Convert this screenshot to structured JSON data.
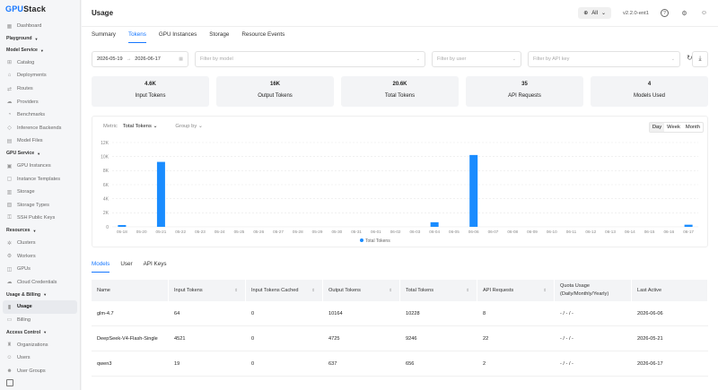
{
  "app": {
    "logo_prefix": "GPU",
    "logo_suffix": "Stack"
  },
  "sidebar": {
    "entries": [
      {
        "kind": "item",
        "label": "Dashboard",
        "icon": "▦",
        "active": false
      },
      {
        "kind": "group",
        "label": "Playground"
      },
      {
        "kind": "group",
        "label": "Model Service"
      },
      {
        "kind": "item",
        "label": "Catalog",
        "icon": "⊞",
        "active": false
      },
      {
        "kind": "item",
        "label": "Deployments",
        "icon": "⌂",
        "active": false
      },
      {
        "kind": "item",
        "label": "Routes",
        "icon": "⇄",
        "active": false
      },
      {
        "kind": "item",
        "label": "Providers",
        "icon": "☁",
        "active": false
      },
      {
        "kind": "item",
        "label": "Benchmarks",
        "icon": "◔",
        "active": false
      },
      {
        "kind": "item",
        "label": "Inference Backends",
        "icon": "◇",
        "active": false
      },
      {
        "kind": "item",
        "label": "Model Files",
        "icon": "▤",
        "active": false
      },
      {
        "kind": "group",
        "label": "GPU Service"
      },
      {
        "kind": "item",
        "label": "GPU Instances",
        "icon": "▣",
        "active": false
      },
      {
        "kind": "item",
        "label": "Instance Templates",
        "icon": "▢",
        "active": false
      },
      {
        "kind": "item",
        "label": "Storage",
        "icon": "▥",
        "active": false
      },
      {
        "kind": "item",
        "label": "Storage Types",
        "icon": "▧",
        "active": false
      },
      {
        "kind": "item",
        "label": "SSH Public Keys",
        "icon": "⚿",
        "active": false
      },
      {
        "kind": "group",
        "label": "Resources"
      },
      {
        "kind": "item",
        "label": "Clusters",
        "icon": "✲",
        "active": false
      },
      {
        "kind": "item",
        "label": "Workers",
        "icon": "⚙",
        "active": false
      },
      {
        "kind": "item",
        "label": "GPUs",
        "icon": "◫",
        "active": false
      },
      {
        "kind": "item",
        "label": "Cloud Credentials",
        "icon": "☁",
        "active": false
      },
      {
        "kind": "group",
        "label": "Usage & Billing"
      },
      {
        "kind": "item",
        "label": "Usage",
        "icon": "▮",
        "active": true
      },
      {
        "kind": "item",
        "label": "Billing",
        "icon": "▭",
        "active": false
      },
      {
        "kind": "group",
        "label": "Access Control"
      },
      {
        "kind": "item",
        "label": "Organizations",
        "icon": "♜",
        "active": false
      },
      {
        "kind": "item",
        "label": "Users",
        "icon": "☺",
        "active": false
      },
      {
        "kind": "item",
        "label": "User Groups",
        "icon": "☻",
        "active": false
      }
    ]
  },
  "header": {
    "title": "Usage",
    "scope": "All",
    "version": "v2.2.0-ent1"
  },
  "tabs": [
    "Summary",
    "Tokens",
    "GPU Instances",
    "Storage",
    "Resource Events"
  ],
  "active_tab": 1,
  "filters": {
    "date_from": "2026-05-19",
    "date_to": "2026-06-17",
    "model_placeholder": "Filter by model",
    "user_placeholder": "Filter by user",
    "apikey_placeholder": "Filter by API key"
  },
  "cards": [
    {
      "value": "4.6K",
      "label": "Input Tokens"
    },
    {
      "value": "16K",
      "label": "Output Tokens"
    },
    {
      "value": "20.6K",
      "label": "Total Tokens"
    },
    {
      "value": "35",
      "label": "API Requests"
    },
    {
      "value": "4",
      "label": "Models Used"
    }
  ],
  "chart_controls": {
    "metric_label": "Metric",
    "metric_value": "Total Tokens",
    "group_by_label": "Group by",
    "periods": [
      "Day",
      "Week",
      "Month"
    ],
    "active_period": 0
  },
  "chart_data": {
    "type": "bar",
    "ylim": [
      0,
      12000
    ],
    "yticks": [
      "0",
      "2K",
      "4K",
      "6K",
      "8K",
      "10K",
      "12K"
    ],
    "categories": [
      "05-18",
      "05-20",
      "05-21",
      "05-22",
      "05-23",
      "05-24",
      "05-25",
      "05-26",
      "05-27",
      "05-28",
      "05-29",
      "05-30",
      "05-31",
      "06-01",
      "06-02",
      "06-03",
      "06-04",
      "06-05",
      "06-06",
      "06-07",
      "06-08",
      "06-09",
      "06-10",
      "06-11",
      "06-12",
      "06-13",
      "06-14",
      "06-15",
      "06-16",
      "06-17"
    ],
    "series": [
      {
        "name": "Total Tokens",
        "values": [
          250,
          0,
          9246,
          0,
          0,
          0,
          0,
          0,
          0,
          0,
          0,
          0,
          0,
          0,
          0,
          0,
          656,
          0,
          10228,
          0,
          0,
          0,
          0,
          0,
          0,
          0,
          0,
          0,
          0,
          300
        ]
      }
    ],
    "color": "#1a8cff",
    "grid": true,
    "legend": "bottom-center"
  },
  "sub_tabs": [
    "Models",
    "User",
    "API Keys"
  ],
  "active_sub_tab": 0,
  "table": {
    "columns": [
      {
        "label": "Name",
        "sortable": false
      },
      {
        "label": "Input Tokens",
        "sortable": true
      },
      {
        "label": "Input Tokens Cached",
        "sortable": true
      },
      {
        "label": "Output Tokens",
        "sortable": true
      },
      {
        "label": "Total Tokens",
        "sortable": true
      },
      {
        "label": "API Requests",
        "sortable": true
      },
      {
        "label": "Quota Usage (Daily/Monthly/Yearly)",
        "sortable": false
      },
      {
        "label": "Last Active",
        "sortable": false
      }
    ],
    "rows": [
      [
        "glm-4.7",
        "64",
        "0",
        "10164",
        "10228",
        "8",
        "- / - / -",
        "2026-06-06"
      ],
      [
        "DeepSeek-V4-Flash-Single",
        "4521",
        "0",
        "4725",
        "9246",
        "22",
        "- / - / -",
        "2026-05-21"
      ],
      [
        "qwen3",
        "19",
        "0",
        "637",
        "656",
        "2",
        "- / - / -",
        "2026-06-17"
      ]
    ]
  }
}
